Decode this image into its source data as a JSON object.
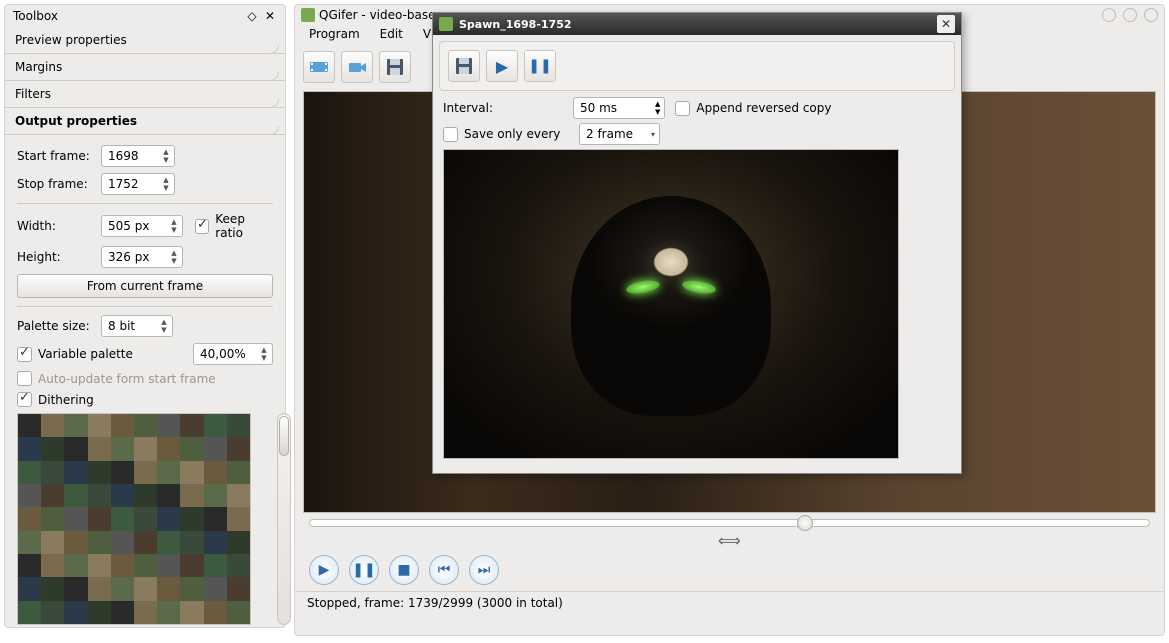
{
  "toolbox": {
    "title": "Toolbox",
    "sections": {
      "preview": "Preview properties",
      "margins": "Margins",
      "filters": "Filters",
      "output": "Output properties"
    },
    "start_frame_label": "Start frame:",
    "start_frame": "1698",
    "stop_frame_label": "Stop frame:",
    "stop_frame": "1752",
    "width_label": "Width:",
    "width": "505 px",
    "height_label": "Height:",
    "height": "326 px",
    "keep_ratio": "Keep ratio",
    "from_current": "From current frame",
    "palette_size_label": "Palette size:",
    "palette_size": "8 bit",
    "variable_palette": "Variable palette",
    "variable_palette_pct": "40,00%",
    "auto_update": "Auto-update form start frame",
    "dithering": "Dithering"
  },
  "mainwin": {
    "title": "QGifer - video-base…",
    "menu": {
      "program": "Program",
      "edit": "Edit",
      "view": "Vie…"
    },
    "status": "Stopped, frame: 1739/2999 (3000 in total)"
  },
  "dialog": {
    "title": "Spawn_1698-1752",
    "interval_label": "Interval:",
    "interval": "50 ms",
    "append_reversed": "Append reversed copy",
    "save_only_label": "Save only every",
    "save_only": "2 frame"
  }
}
